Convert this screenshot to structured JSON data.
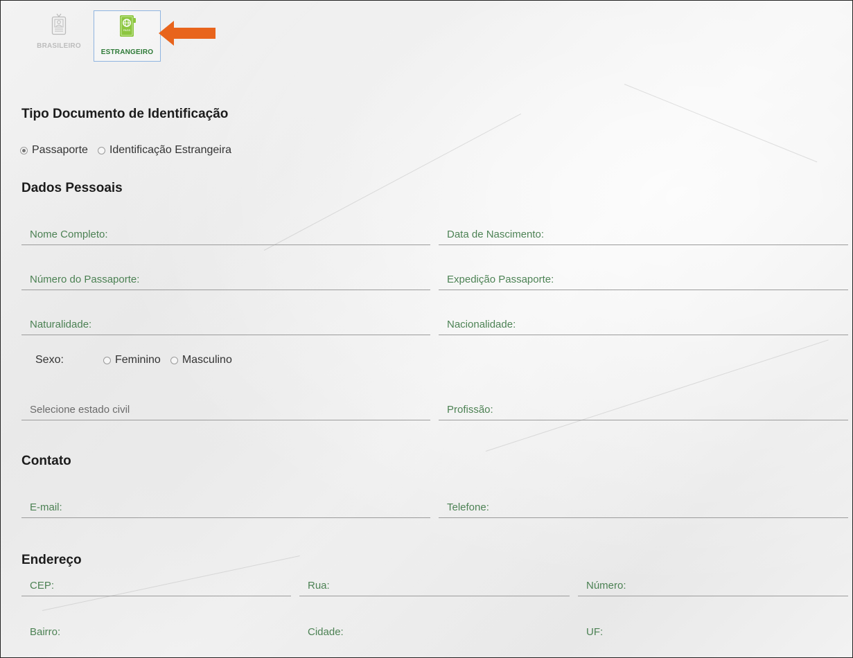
{
  "tabs": [
    {
      "label": "BRASILEIRO",
      "icon": "id-card-icon",
      "selected": false
    },
    {
      "label": "ESTRANGEIRO",
      "icon": "passport-icon",
      "selected": true
    }
  ],
  "passport_icon_text": "PASS",
  "colors": {
    "accent_green": "#2d7a36",
    "arrow_orange": "#e8641c",
    "selected_border": "#8fb4e0"
  },
  "sections": {
    "tipo_documento": {
      "title": "Tipo Documento de Identificação",
      "options": [
        "Passaporte",
        "Identificação Estrangeira"
      ],
      "selected": "Passaporte"
    },
    "dados_pessoais": {
      "title": "Dados Pessoais",
      "fields": {
        "nome": "Nome Completo:",
        "nascimento": "Data de Nascimento:",
        "passaporte": "Número do Passaporte:",
        "expedicao": "Expedição Passaporte:",
        "naturalidade": "Naturalidade:",
        "nacionalidade": "Nacionalidade:",
        "estado_civil": "Selecione estado civil",
        "profissao": "Profissão:"
      },
      "sexo": {
        "label": "Sexo:",
        "options": [
          "Feminino",
          "Masculino"
        ]
      }
    },
    "contato": {
      "title": "Contato",
      "fields": {
        "email": "E-mail:",
        "telefone": "Telefone:"
      }
    },
    "endereco": {
      "title": "Endereço",
      "fields": {
        "cep": "CEP:",
        "rua": "Rua:",
        "numero": "Número:",
        "bairro": "Bairro:",
        "cidade": "Cidade:",
        "uf": "UF:"
      }
    }
  }
}
